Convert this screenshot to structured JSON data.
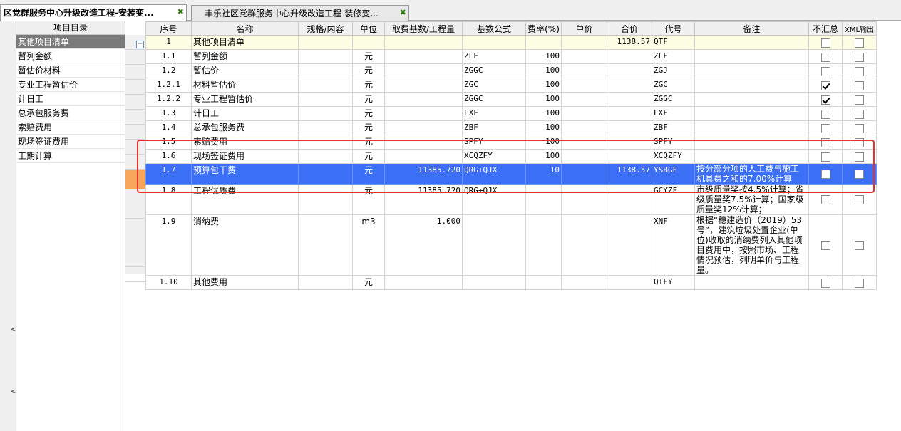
{
  "tabs": [
    {
      "title": "区党群服务中心升级改造工程-安装变...",
      "active": true
    },
    {
      "title": "丰乐社区党群服务中心升级改造工程-装修变...",
      "active": false
    }
  ],
  "sidebar": {
    "header": "项目目录",
    "items": [
      {
        "label": "其他项目清单"
      },
      {
        "label": "暂列金额"
      },
      {
        "label": "暂估价材料"
      },
      {
        "label": "专业工程暂估价"
      },
      {
        "label": "计日工"
      },
      {
        "label": "总承包服务费"
      },
      {
        "label": "索赔费用"
      },
      {
        "label": "现场签证费用"
      },
      {
        "label": "工期计算"
      }
    ]
  },
  "table": {
    "columns": [
      "序号",
      "名称",
      "规格/内容",
      "单位",
      "取费基数/工程量",
      "基数公式",
      "费率(%)",
      "单价",
      "合价",
      "代号",
      "备注",
      "不汇总",
      "XML输出"
    ],
    "rows": [
      {
        "no": "1",
        "name": "其他项目清单",
        "spec": "",
        "unit": "",
        "base": "",
        "formula": "",
        "rate": "",
        "price": "",
        "total": "1138.57",
        "code": "QTF",
        "note": "",
        "nosum": false,
        "xml": false
      },
      {
        "no": "1.1",
        "name": "暂列金额",
        "spec": "",
        "unit": "元",
        "base": "",
        "formula": "ZLF",
        "rate": "100",
        "price": "",
        "total": "",
        "code": "ZLF",
        "note": "",
        "nosum": false,
        "xml": false
      },
      {
        "no": "1.2",
        "name": "暂估价",
        "spec": "",
        "unit": "元",
        "base": "",
        "formula": "ZGGC",
        "rate": "100",
        "price": "",
        "total": "",
        "code": "ZGJ",
        "note": "",
        "nosum": false,
        "xml": false
      },
      {
        "no": "1.2.1",
        "name": "材料暂估价",
        "spec": "",
        "unit": "元",
        "base": "",
        "formula": "ZGC",
        "rate": "100",
        "price": "",
        "total": "",
        "code": "ZGC",
        "note": "",
        "nosum": true,
        "xml": false
      },
      {
        "no": "1.2.2",
        "name": "专业工程暂估价",
        "spec": "",
        "unit": "元",
        "base": "",
        "formula": "ZGGC",
        "rate": "100",
        "price": "",
        "total": "",
        "code": "ZGGC",
        "note": "",
        "nosum": true,
        "xml": false
      },
      {
        "no": "1.3",
        "name": "计日工",
        "spec": "",
        "unit": "元",
        "base": "",
        "formula": "LXF",
        "rate": "100",
        "price": "",
        "total": "",
        "code": "LXF",
        "note": "",
        "nosum": false,
        "xml": false
      },
      {
        "no": "1.4",
        "name": "总承包服务费",
        "spec": "",
        "unit": "元",
        "base": "",
        "formula": "ZBF",
        "rate": "100",
        "price": "",
        "total": "",
        "code": "ZBF",
        "note": "",
        "nosum": false,
        "xml": false
      },
      {
        "no": "1.5",
        "name": "索赔费用",
        "spec": "",
        "unit": "元",
        "base": "",
        "formula": "SPFY",
        "rate": "100",
        "price": "",
        "total": "",
        "code": "SPFY",
        "note": "",
        "nosum": false,
        "xml": false
      },
      {
        "no": "1.6",
        "name": "现场签证费用",
        "spec": "",
        "unit": "元",
        "base": "",
        "formula": "XCQZFY",
        "rate": "100",
        "price": "",
        "total": "",
        "code": "XCQZFY",
        "note": "",
        "nosum": false,
        "xml": false
      },
      {
        "no": "1.7",
        "name": "预算包干费",
        "spec": "",
        "unit": "元",
        "base": "11385.720",
        "formula": "QRG+QJX",
        "rate": "10",
        "price": "",
        "total": "1138.57",
        "code": "YSBGF",
        "note": "按分部分项的人工费与施工机具费之和的7.00%计算",
        "nosum": false,
        "xml": false
      },
      {
        "no": "1.8",
        "name": "工程优质费",
        "spec": "",
        "unit": "元",
        "base": "11385.720",
        "formula": "QRG+QJX",
        "rate": "",
        "price": "",
        "total": "",
        "code": "GCYZF",
        "note": "市级质量奖按4.5%计算；省级质量奖7.5%计算；国家级质量奖12%计算；",
        "nosum": false,
        "xml": false
      },
      {
        "no": "1.9",
        "name": "消纳费",
        "spec": "",
        "unit": "m3",
        "base": "1.000",
        "formula": "",
        "rate": "",
        "price": "",
        "total": "",
        "code": "XNF",
        "note": "根据“穗建造价（2019）53号”，建筑垃圾处置企业(单位)收取的消纳费列入其他项目费用中，按照市场、工程情况预估，列明单价与工程量。",
        "nosum": false,
        "xml": false
      },
      {
        "no": "1.10",
        "name": "其他费用",
        "spec": "",
        "unit": "元",
        "base": "",
        "formula": "",
        "rate": "",
        "price": "",
        "total": "",
        "code": "QTFY",
        "note": "",
        "nosum": false,
        "xml": false
      }
    ],
    "selected_row": 9
  },
  "colors": {
    "selection": "#3b6ff5",
    "parent_row": "#fdfde4",
    "annotation_box": "#e8322e",
    "row_marker": "#f5a65b"
  }
}
